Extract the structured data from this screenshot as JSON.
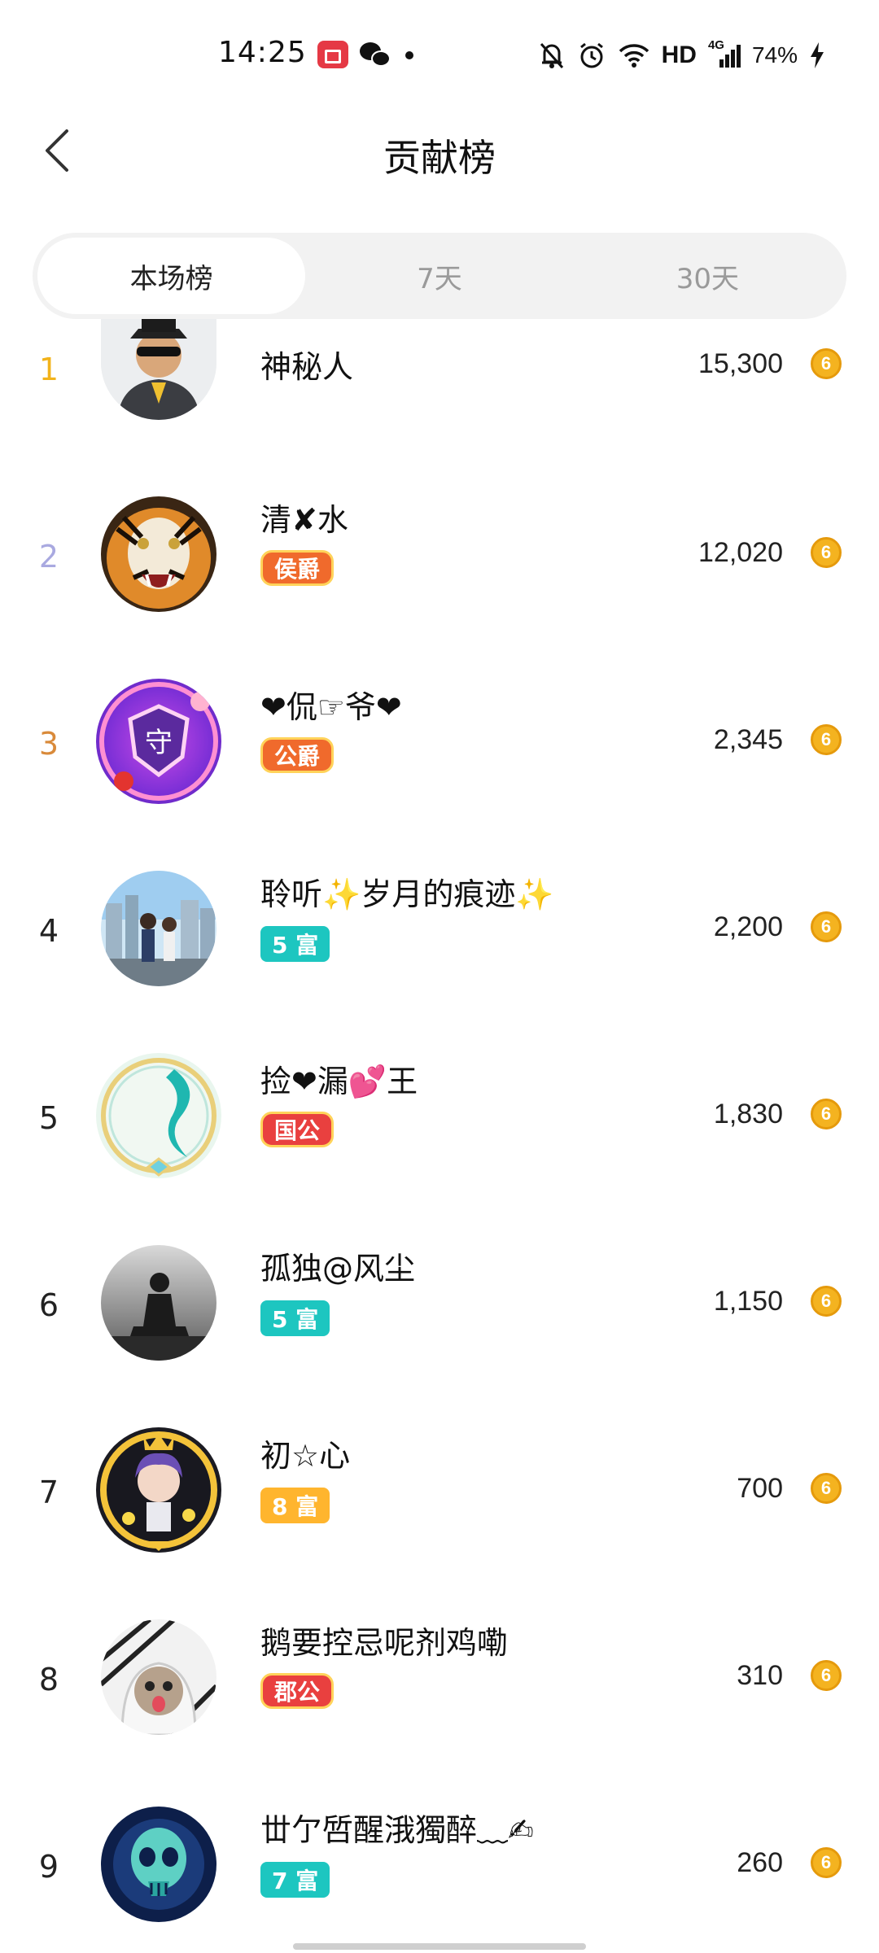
{
  "status_bar": {
    "time": "14:25",
    "network": "HD",
    "signal_label": "4G",
    "battery": "74%"
  },
  "header": {
    "back_icon": "chevron-left-icon",
    "title": "贡献榜"
  },
  "tabs": [
    {
      "label": "本场榜",
      "active": true
    },
    {
      "label": "7天",
      "active": false
    },
    {
      "label": "30天",
      "active": false
    }
  ],
  "colors": {
    "rank_1": "#f2b31b",
    "rank_2": "#a9a9e0",
    "rank_3": "#d98a3a",
    "rank_default": "#222222",
    "badge_teal": "#1dc6c0",
    "badge_yellow": "#ffb52e",
    "badge_orange": "#f06a2c",
    "badge_red": "#e9403f"
  },
  "ranking": [
    {
      "rank": "1",
      "name": "神秘人",
      "badge": "",
      "score": "15,300"
    },
    {
      "rank": "2",
      "name": "清✘水",
      "badge": "侯爵",
      "score": "12,020"
    },
    {
      "rank": "3",
      "name": "❤侃☞爷❤",
      "badge": "公爵",
      "score": "2,345"
    },
    {
      "rank": "4",
      "name": "聆听✨岁月的痕迹✨",
      "badge": "5 富",
      "score": "2,200"
    },
    {
      "rank": "5",
      "name": "捡❤漏💕王",
      "badge": "国公",
      "score": "1,830"
    },
    {
      "rank": "6",
      "name": "孤独@风尘",
      "badge": "5 富",
      "score": "1,150"
    },
    {
      "rank": "7",
      "name": "初☆心",
      "badge": "8 富",
      "score": "700"
    },
    {
      "rank": "8",
      "name": "鹅要控忌呢剂鸡嘞",
      "badge": "郡公",
      "score": "310"
    },
    {
      "rank": "9",
      "name": "丗亇啠醒涐獨醉﹏✍",
      "badge": "7 富",
      "score": "260"
    }
  ],
  "coin_icon": "coin-icon",
  "coin_glyph": "6"
}
